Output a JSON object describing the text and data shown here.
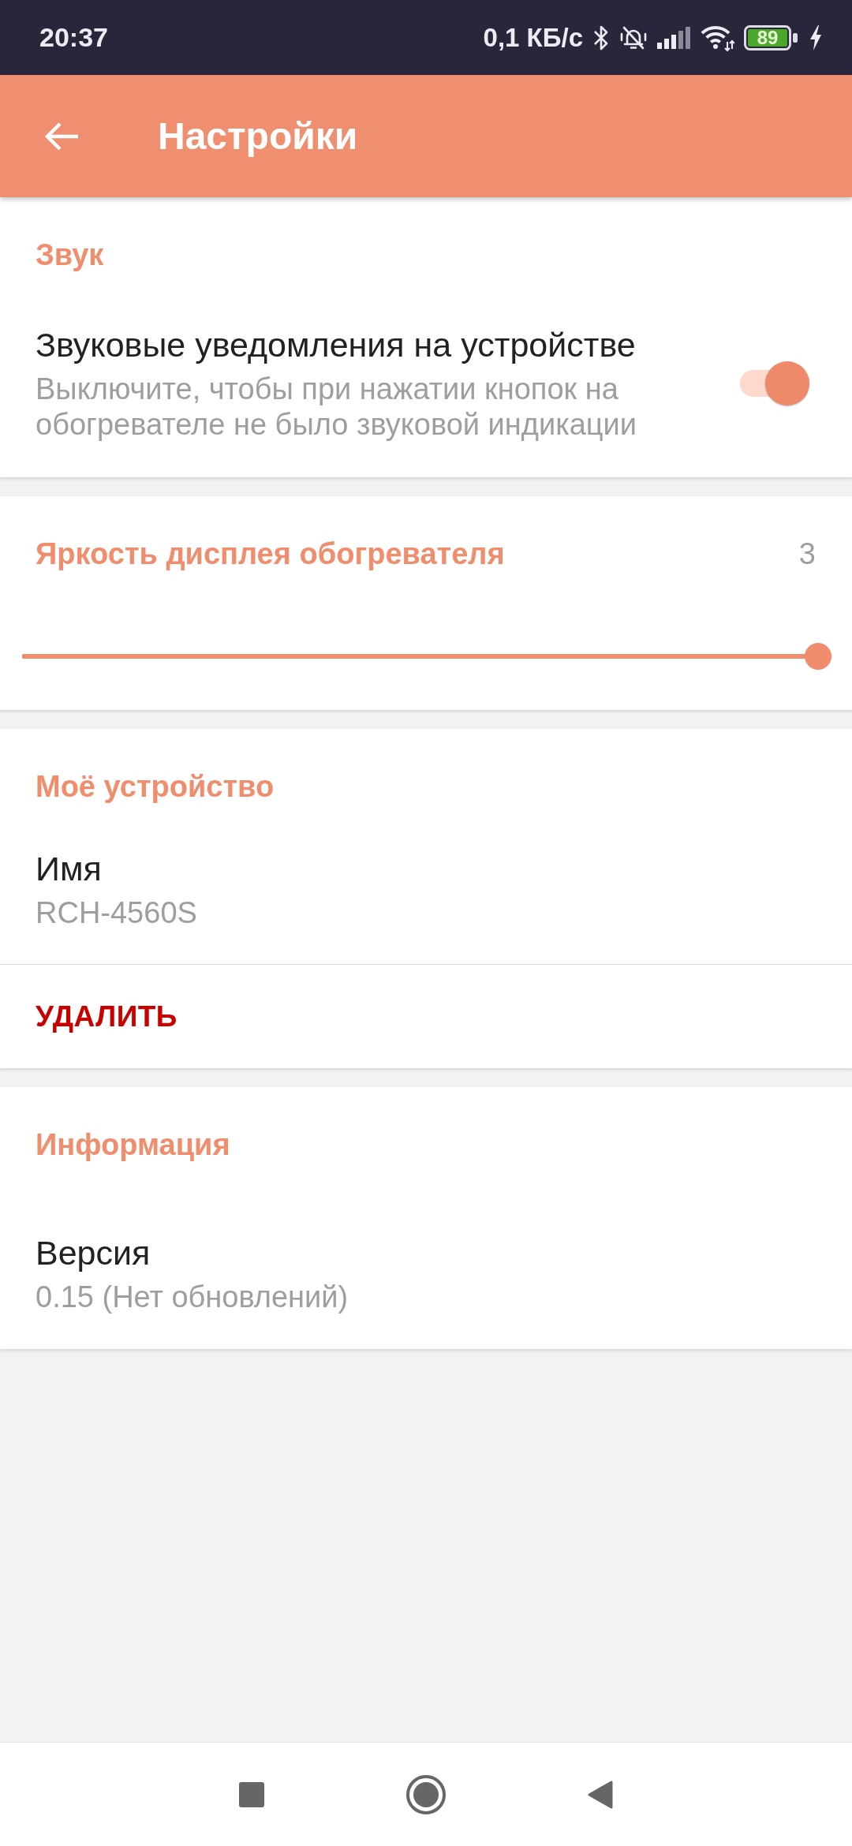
{
  "status_bar": {
    "time": "20:37",
    "network_speed": "0,1 КБ/с",
    "battery": "89"
  },
  "app_bar": {
    "title": "Настройки"
  },
  "sections": [
    {
      "title": "Звук",
      "items": [
        {
          "kind": "switch",
          "title": "Звуковые уведомления на устройстве",
          "summary": "Выключите, чтобы при нажатии кнопок на обогревателе не было звуковой индикации",
          "on": true
        }
      ]
    },
    {
      "items": [
        {
          "kind": "slider",
          "title": "Яркость дисплея обогревателя",
          "reading": "3",
          "level": 1
        }
      ]
    },
    {
      "title": "Моё устройство",
      "items": [
        {
          "kind": "info",
          "title": "Имя",
          "summary": "RCH-4560S"
        },
        {
          "kind": "action",
          "label": "УДАЛИТЬ"
        }
      ]
    },
    {
      "title": "Информация",
      "items": [
        {
          "kind": "info",
          "title": "Версия",
          "summary": "0.15 (Нет обновлений)"
        }
      ]
    }
  ]
}
